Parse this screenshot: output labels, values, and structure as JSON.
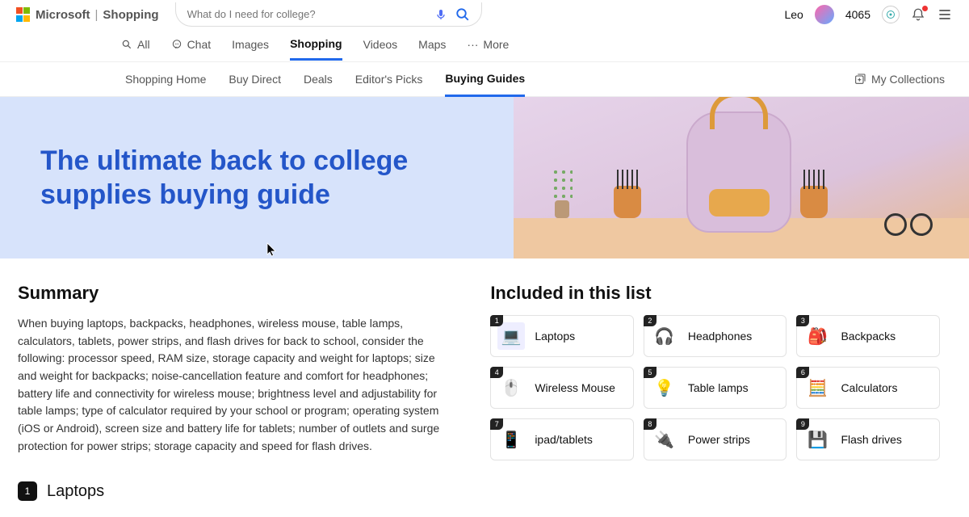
{
  "header": {
    "brand_ms": "Microsoft",
    "brand_sep": "|",
    "brand_shop": "Shopping",
    "search_placeholder": "What do I need for college?",
    "user_name": "Leo",
    "points": "4065"
  },
  "scopes": {
    "all": "All",
    "chat": "Chat",
    "images": "Images",
    "shopping": "Shopping",
    "videos": "Videos",
    "maps": "Maps",
    "more": "More"
  },
  "subnav": {
    "home": "Shopping Home",
    "buy_direct": "Buy Direct",
    "deals": "Deals",
    "editors": "Editor's Picks",
    "buying_guides": "Buying Guides",
    "collections": "My Collections"
  },
  "hero": {
    "title": "The ultimate back to college supplies buying guide"
  },
  "summary": {
    "heading": "Summary",
    "text": "When buying laptops, backpacks, headphones, wireless mouse, table lamps, calculators, tablets, power strips, and flash drives for back to school, consider the following: processor speed, RAM size, storage capacity and weight for laptops; size and weight for backpacks; noise-cancellation feature and comfort for headphones; battery life and connectivity for wireless mouse; brightness level and adjustability for table lamps; type of calculator required by your school or program; operating system (iOS or Android), screen size and battery life for tablets; number of outlets and surge protection for power strips; storage capacity and speed for flash drives."
  },
  "included": {
    "heading": "Included in this list",
    "items": [
      {
        "n": "1",
        "label": "Laptops",
        "icon": "💻",
        "bg": "#eef"
      },
      {
        "n": "2",
        "label": "Headphones",
        "icon": "🎧",
        "bg": "#fff"
      },
      {
        "n": "3",
        "label": "Backpacks",
        "icon": "🎒",
        "bg": "#fff"
      },
      {
        "n": "4",
        "label": "Wireless Mouse",
        "icon": "🖱️",
        "bg": "#fff"
      },
      {
        "n": "5",
        "label": "Table lamps",
        "icon": "💡",
        "bg": "#fff"
      },
      {
        "n": "6",
        "label": "Calculators",
        "icon": "🧮",
        "bg": "#fff"
      },
      {
        "n": "7",
        "label": "ipad/tablets",
        "icon": "📱",
        "bg": "#fff"
      },
      {
        "n": "8",
        "label": "Power strips",
        "icon": "🔌",
        "bg": "#fff"
      },
      {
        "n": "9",
        "label": "Flash drives",
        "icon": "💾",
        "bg": "#fff"
      }
    ]
  },
  "section": {
    "first_num": "1",
    "first_title": "Laptops"
  }
}
